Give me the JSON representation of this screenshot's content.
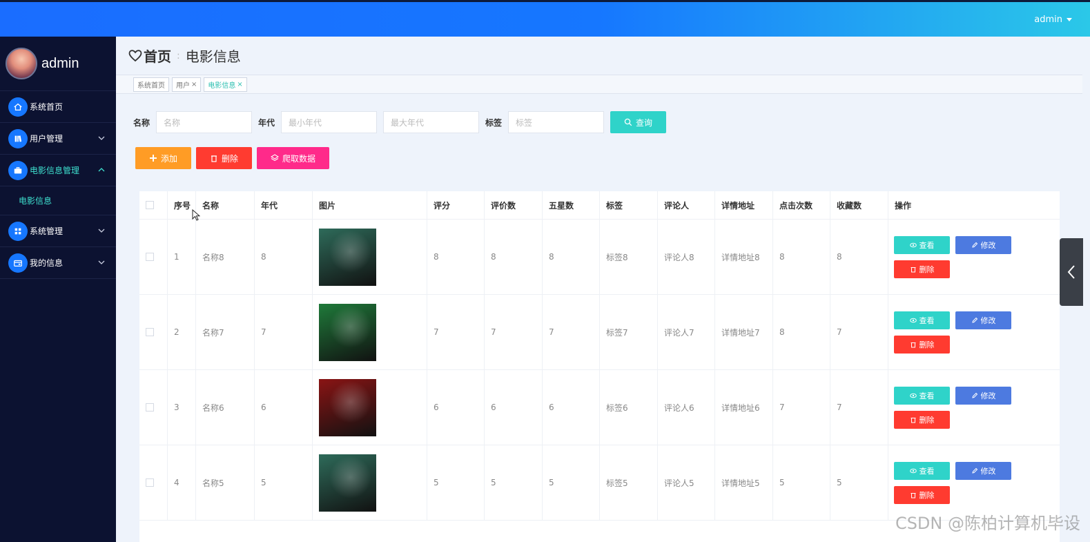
{
  "header": {
    "user": "admin"
  },
  "sidebar": {
    "profile_name": "admin",
    "items": [
      {
        "label": "系统首页",
        "icon": "home-icon"
      },
      {
        "label": "用户管理",
        "icon": "books-icon"
      },
      {
        "label": "电影信息管理",
        "icon": "briefcase-icon"
      },
      {
        "label": "系统管理",
        "icon": "grid-icon"
      },
      {
        "label": "我的信息",
        "icon": "wallet-icon"
      }
    ],
    "subitem": "电影信息"
  },
  "breadcrumb": {
    "home": "首页",
    "separator": ":",
    "current": "电影信息"
  },
  "tags": [
    {
      "label": "系统首页"
    },
    {
      "label": "用户",
      "close": "×"
    },
    {
      "label": "电影信息",
      "close": "×"
    }
  ],
  "search": {
    "name_label": "名称",
    "name_placeholder": "名称",
    "year_label": "年代",
    "min_year_placeholder": "最小年代",
    "max_year_placeholder": "最大年代",
    "tag_label": "标签",
    "tag_placeholder": "标签",
    "query_button": "查询"
  },
  "actions": {
    "add": "添加",
    "delete": "删除",
    "crawl": "爬取数据"
  },
  "table": {
    "columns": [
      "序号",
      "名称",
      "年代",
      "图片",
      "评分",
      "评价数",
      "五星数",
      "标签",
      "评论人",
      "详情地址",
      "点击次数",
      "收藏数",
      "操作"
    ],
    "rows": [
      {
        "index": "1",
        "name": "名称8",
        "year": "8",
        "score": "8",
        "reviews": "8",
        "five_star": "8",
        "tag": "标签8",
        "reviewer": "评论人8",
        "url": "详情地址8",
        "clicks": "8",
        "favorites": "8",
        "poster": "#2e6b5a"
      },
      {
        "index": "2",
        "name": "名称7",
        "year": "7",
        "score": "7",
        "reviews": "7",
        "five_star": "7",
        "tag": "标签7",
        "reviewer": "评论人7",
        "url": "详情地址7",
        "clicks": "8",
        "favorites": "7",
        "poster": "#1f7a3a"
      },
      {
        "index": "3",
        "name": "名称6",
        "year": "6",
        "score": "6",
        "reviews": "6",
        "five_star": "6",
        "tag": "标签6",
        "reviewer": "评论人6",
        "url": "详情地址6",
        "clicks": "7",
        "favorites": "7",
        "poster": "#8a1414"
      },
      {
        "index": "4",
        "name": "名称5",
        "year": "5",
        "score": "5",
        "reviews": "5",
        "five_star": "5",
        "tag": "标签5",
        "reviewer": "评论人5",
        "url": "详情地址5",
        "clicks": "5",
        "favorites": "5",
        "poster": "#2e6b5a"
      }
    ],
    "op_view": "查看",
    "op_edit": "修改",
    "op_delete": "删除"
  },
  "watermark": "CSDN @陈柏计算机毕设"
}
